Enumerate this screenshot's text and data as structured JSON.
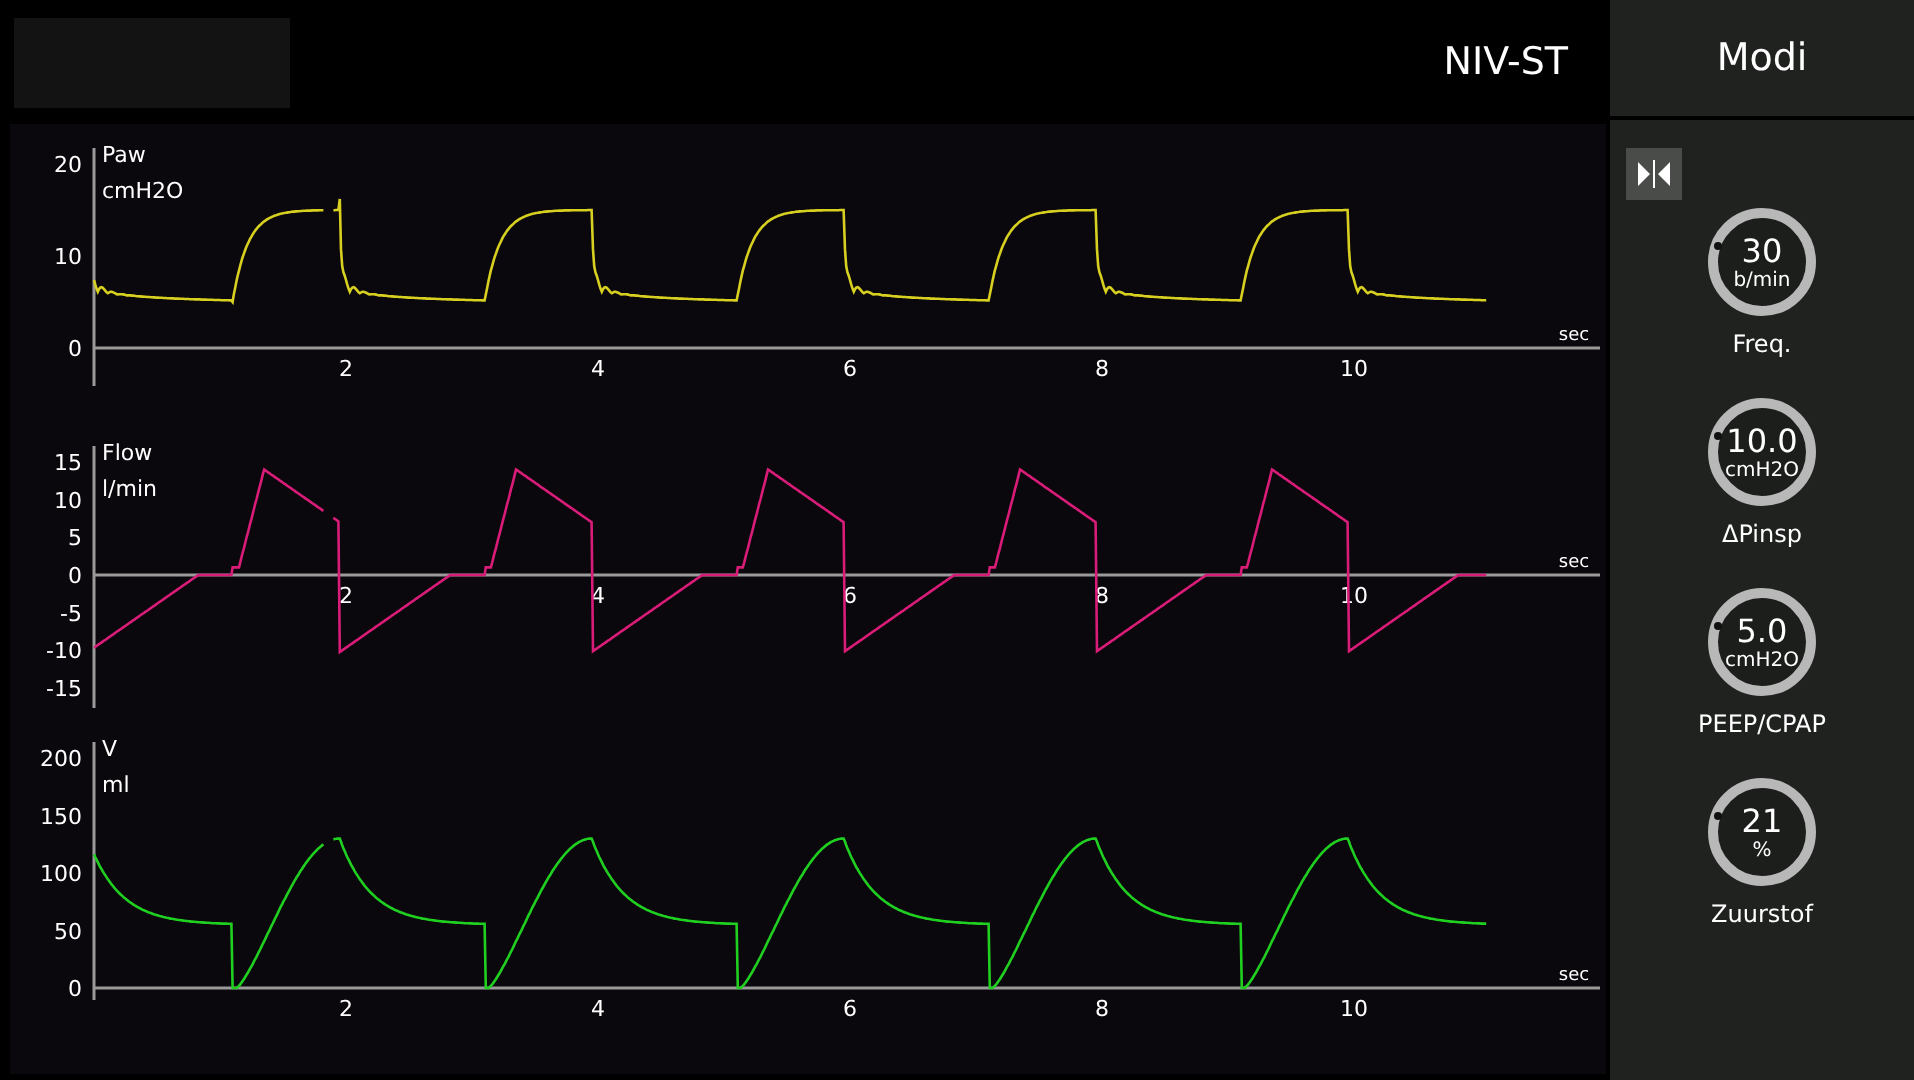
{
  "header": {
    "mode": "NIV-ST",
    "menu_button": "Modi"
  },
  "plots": [
    {
      "kind": "pressure",
      "label": "Paw",
      "unit": "cmH2O",
      "color": "#d8d020",
      "yticks": [
        "20",
        "10",
        "0"
      ],
      "xticks": [
        "2",
        "4",
        "6",
        "8",
        "10"
      ],
      "xunit": "sec"
    },
    {
      "kind": "flow",
      "label": "Flow",
      "unit": "l/min",
      "color": "#d81c78",
      "yticks": [
        "15",
        "10",
        "5",
        "0",
        "-5",
        "-10",
        "-15"
      ],
      "xticks": [
        "2",
        "4",
        "6",
        "8",
        "10"
      ],
      "xunit": "sec"
    },
    {
      "kind": "volume",
      "label": "V",
      "unit": "ml",
      "color": "#20d020",
      "yticks": [
        "200",
        "150",
        "100",
        "50",
        "0"
      ],
      "xticks": [
        "2",
        "4",
        "6",
        "8",
        "10"
      ],
      "xunit": "sec"
    }
  ],
  "settings": [
    {
      "value": "30",
      "unit": "b/min",
      "label": "Freq."
    },
    {
      "value": "10.0",
      "unit": "cmH2O",
      "label": "ΔPinsp"
    },
    {
      "value": "5.0",
      "unit": "cmH2O",
      "label": "PEEP/CPAP"
    },
    {
      "value": "21",
      "unit": "%",
      "label": "Zuurstof"
    }
  ]
}
